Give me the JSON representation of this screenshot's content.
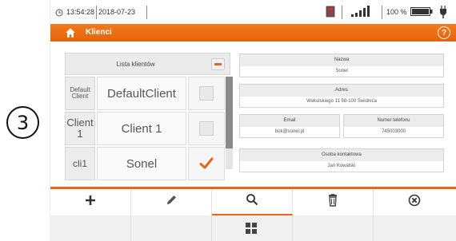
{
  "step_number": "3",
  "statusbar": {
    "time": "13:54:28",
    "date": "2018-07-23",
    "battery_percent": "100 %"
  },
  "titlebar": {
    "title": "Klienci",
    "help_label": "?"
  },
  "client_list": {
    "header_label": "Lista klientów",
    "rows": [
      {
        "short": "Default Client",
        "name": "DefaultClient",
        "selected": false
      },
      {
        "short": "Client 1",
        "name": "Client 1",
        "selected": false
      },
      {
        "short": "cli1",
        "name": "Sonel",
        "selected": true
      }
    ]
  },
  "details": {
    "name_label": "Nazwa",
    "name_value": "Sonel",
    "address_label": "Adres",
    "address_value": "Wokulskiego 11 58-100 Świdnica",
    "email_label": "Email",
    "email_value": "bok@sonel.pl",
    "phone_label": "Numer telefonu",
    "phone_value": "745003000",
    "contact_label": "Osoba kontaktowa",
    "contact_value": "Jan Kowalski"
  },
  "toolbar": {
    "items": [
      "add-icon",
      "edit-icon",
      "search-icon",
      "delete-icon",
      "close-icon"
    ],
    "active_item": "search-icon"
  },
  "colors": {
    "accent": "#e8651b",
    "selected_check": "#e8651b"
  }
}
